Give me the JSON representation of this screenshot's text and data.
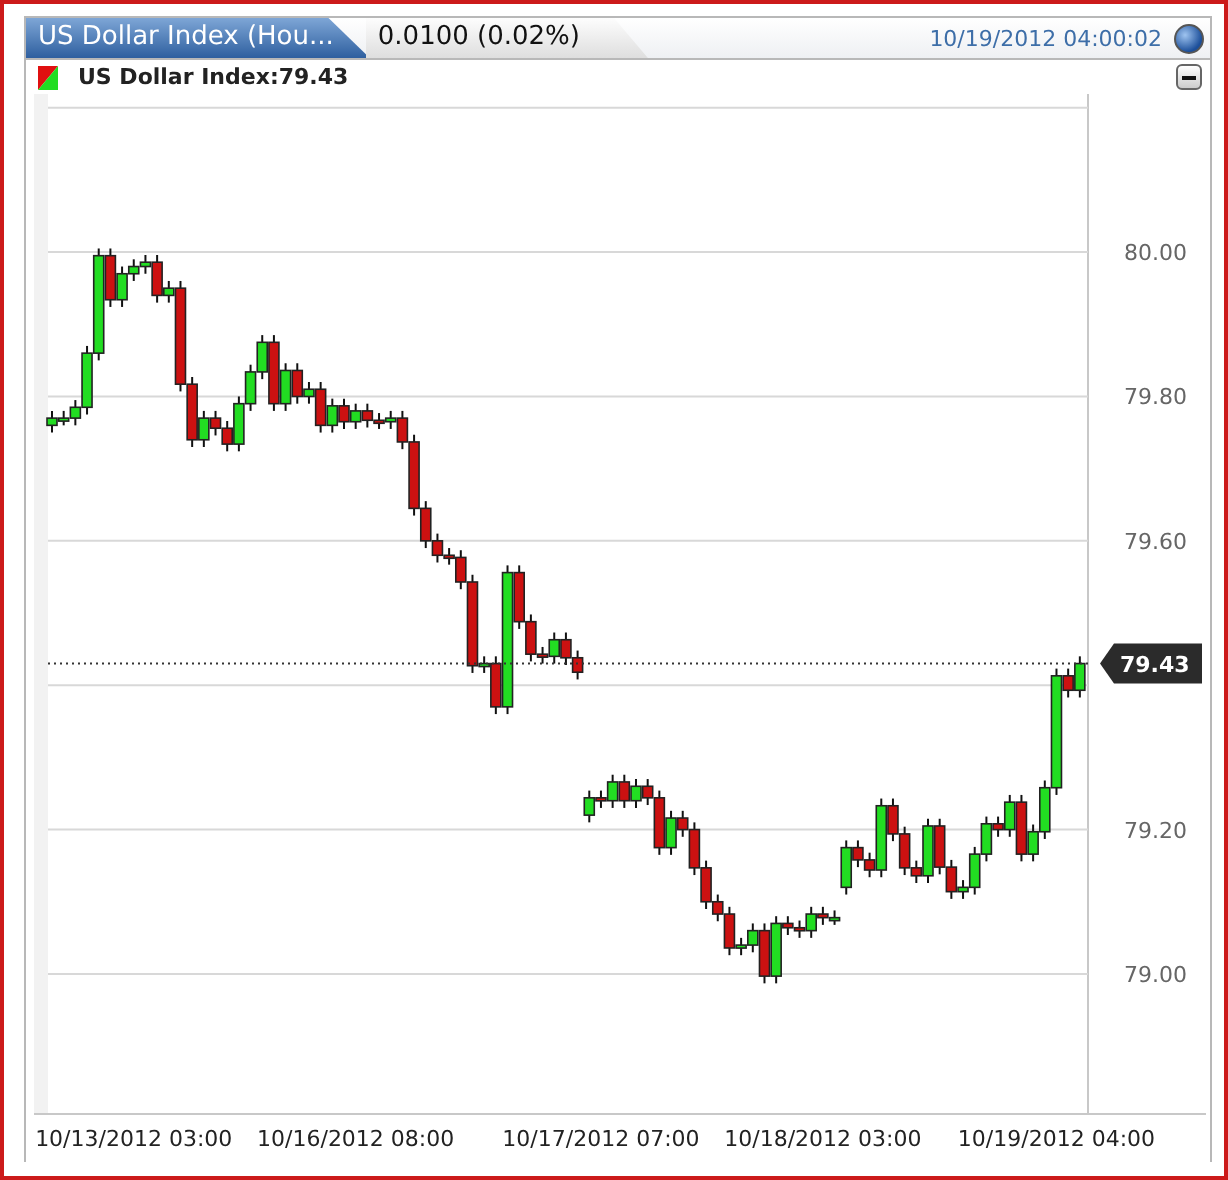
{
  "header": {
    "tab_title": "US Dollar Index (Hou...",
    "change": "0.0100 (0.02%)",
    "timestamp": "10/19/2012 04:00:02"
  },
  "legend": {
    "label": "US Dollar Index:79.43"
  },
  "chart": {
    "chart_data": {
      "type": "candlestick",
      "grid": true,
      "ylim": [
        78.806,
        80.219
      ],
      "yticks": [
        {
          "value": 80,
          "label": "80.00"
        },
        {
          "value": 79.8,
          "label": "79.80"
        },
        {
          "value": 79.6,
          "label": "79.60"
        },
        {
          "value": 79.2,
          "label": "79.20"
        },
        {
          "value": 79,
          "label": "79.00"
        }
      ],
      "categories": [
        null,
        null,
        null,
        null,
        null,
        null,
        null,
        "10/13/2012 03:00",
        null,
        null,
        null,
        null,
        null,
        null,
        null,
        null,
        null,
        null,
        null,
        null,
        null,
        null,
        null,
        null,
        null,
        null,
        "10/16/2012 08:00",
        null,
        null,
        null,
        null,
        null,
        null,
        null,
        null,
        null,
        null,
        null,
        null,
        null,
        null,
        null,
        null,
        null,
        null,
        null,
        null,
        "10/17/2012 07:00",
        null,
        null,
        null,
        null,
        null,
        null,
        null,
        null,
        null,
        null,
        null,
        null,
        null,
        null,
        null,
        null,
        null,
        null,
        "10/18/2012 03:00",
        null,
        null,
        null,
        null,
        null,
        null,
        null,
        null,
        null,
        null,
        null,
        null,
        null,
        null,
        null,
        null,
        null,
        null,
        null,
        "10/19/2012 04:00",
        null,
        null
      ],
      "ohlc": [
        [
          79.76,
          79.78,
          79.75,
          79.77
        ],
        [
          79.77,
          79.78,
          79.76,
          79.77
        ],
        [
          79.77,
          79.795,
          79.76,
          79.785
        ],
        [
          79.785,
          79.87,
          79.775,
          79.86
        ],
        [
          79.86,
          80.005,
          79.85,
          79.995
        ],
        [
          79.995,
          80.005,
          79.924,
          79.934
        ],
        [
          79.934,
          79.98,
          79.924,
          79.97
        ],
        [
          79.97,
          79.99,
          79.96,
          79.98
        ],
        [
          79.98,
          79.996,
          79.97,
          79.986
        ],
        [
          79.986,
          79.996,
          79.93,
          79.94
        ],
        [
          79.94,
          79.96,
          79.93,
          79.95
        ],
        [
          79.95,
          79.96,
          79.807,
          79.817
        ],
        [
          79.817,
          79.827,
          79.73,
          79.74
        ],
        [
          79.74,
          79.78,
          79.73,
          79.77
        ],
        [
          79.77,
          79.78,
          79.746,
          79.756
        ],
        [
          79.756,
          79.766,
          79.724,
          79.734
        ],
        [
          79.734,
          79.8,
          79.724,
          79.79
        ],
        [
          79.79,
          79.844,
          79.78,
          79.834
        ],
        [
          79.834,
          79.885,
          79.824,
          79.875
        ],
        [
          79.875,
          79.885,
          79.78,
          79.79
        ],
        [
          79.79,
          79.846,
          79.78,
          79.836
        ],
        [
          79.836,
          79.846,
          79.79,
          79.8
        ],
        [
          79.8,
          79.82,
          79.79,
          79.81
        ],
        [
          79.81,
          79.82,
          79.75,
          79.76
        ],
        [
          79.76,
          79.797,
          79.75,
          79.787
        ],
        [
          79.787,
          79.797,
          79.755,
          79.765
        ],
        [
          79.765,
          79.79,
          79.755,
          79.78
        ],
        [
          79.78,
          79.79,
          79.757,
          79.767
        ],
        [
          79.767,
          79.777,
          79.755,
          79.765
        ],
        [
          79.765,
          79.78,
          79.755,
          79.77
        ],
        [
          79.77,
          79.78,
          79.727,
          79.737
        ],
        [
          79.737,
          79.747,
          79.635,
          79.645
        ],
        [
          79.645,
          79.655,
          79.59,
          79.6
        ],
        [
          79.6,
          79.61,
          79.57,
          79.58
        ],
        [
          79.58,
          79.59,
          79.567,
          79.577
        ],
        [
          79.577,
          79.587,
          79.533,
          79.543
        ],
        [
          79.543,
          79.553,
          79.417,
          79.427
        ],
        [
          79.427,
          79.44,
          79.417,
          79.43
        ],
        [
          79.43,
          79.44,
          79.36,
          79.37
        ],
        [
          79.37,
          79.566,
          79.36,
          79.556
        ],
        [
          79.556,
          79.566,
          79.478,
          79.488
        ],
        [
          79.488,
          79.498,
          79.433,
          79.443
        ],
        [
          79.443,
          79.453,
          79.43,
          79.44
        ],
        [
          79.44,
          79.473,
          79.43,
          79.463
        ],
        [
          79.463,
          79.473,
          79.428,
          79.438
        ],
        [
          79.438,
          79.448,
          79.408,
          79.418
        ],
        [
          79.22,
          79.254,
          79.21,
          79.244
        ],
        [
          79.244,
          79.254,
          79.23,
          79.24
        ],
        [
          79.24,
          79.276,
          79.23,
          79.266
        ],
        [
          79.266,
          79.276,
          79.23,
          79.24
        ],
        [
          79.24,
          79.27,
          79.23,
          79.26
        ],
        [
          79.26,
          79.27,
          79.234,
          79.244
        ],
        [
          79.244,
          79.254,
          79.165,
          79.175
        ],
        [
          79.175,
          79.226,
          79.165,
          79.216
        ],
        [
          79.216,
          79.226,
          79.19,
          79.2
        ],
        [
          79.2,
          79.21,
          79.137,
          79.147
        ],
        [
          79.147,
          79.157,
          79.09,
          79.1
        ],
        [
          79.1,
          79.11,
          79.073,
          79.083
        ],
        [
          79.083,
          79.093,
          79.026,
          79.036
        ],
        [
          79.036,
          79.05,
          79.026,
          79.04
        ],
        [
          79.04,
          79.07,
          79.03,
          79.06
        ],
        [
          79.06,
          79.07,
          78.987,
          78.997
        ],
        [
          78.997,
          79.08,
          78.987,
          79.07
        ],
        [
          79.07,
          79.08,
          79.054,
          79.064
        ],
        [
          79.064,
          79.074,
          79.05,
          79.06
        ],
        [
          79.06,
          79.093,
          79.05,
          79.083
        ],
        [
          79.083,
          79.093,
          79.068,
          79.078
        ],
        [
          79.078,
          79.088,
          79.068,
          79.078
        ],
        [
          79.12,
          79.185,
          79.11,
          79.175
        ],
        [
          79.175,
          79.185,
          79.148,
          79.158
        ],
        [
          79.158,
          79.168,
          79.134,
          79.144
        ],
        [
          79.144,
          79.243,
          79.134,
          79.233
        ],
        [
          79.233,
          79.243,
          79.184,
          79.194
        ],
        [
          79.194,
          79.204,
          79.137,
          79.147
        ],
        [
          79.147,
          79.157,
          79.126,
          79.136
        ],
        [
          79.136,
          79.215,
          79.126,
          79.205
        ],
        [
          79.205,
          79.215,
          79.138,
          79.148
        ],
        [
          79.148,
          79.158,
          79.104,
          79.114
        ],
        [
          79.114,
          79.13,
          79.104,
          79.12
        ],
        [
          79.12,
          79.176,
          79.11,
          79.166
        ],
        [
          79.166,
          79.218,
          79.156,
          79.208
        ],
        [
          79.208,
          79.218,
          79.19,
          79.2
        ],
        [
          79.2,
          79.248,
          79.19,
          79.238
        ],
        [
          79.238,
          79.248,
          79.156,
          79.166
        ],
        [
          79.166,
          79.207,
          79.156,
          79.197
        ],
        [
          79.197,
          79.268,
          79.187,
          79.258
        ],
        [
          79.258,
          79.423,
          79.248,
          79.413
        ],
        [
          79.413,
          79.423,
          79.383,
          79.393
        ],
        [
          79.393,
          79.44,
          79.383,
          79.43
        ]
      ],
      "ref_lines": [
        {
          "axis": "y",
          "value": 79.43,
          "label": "79.43"
        }
      ]
    }
  }
}
